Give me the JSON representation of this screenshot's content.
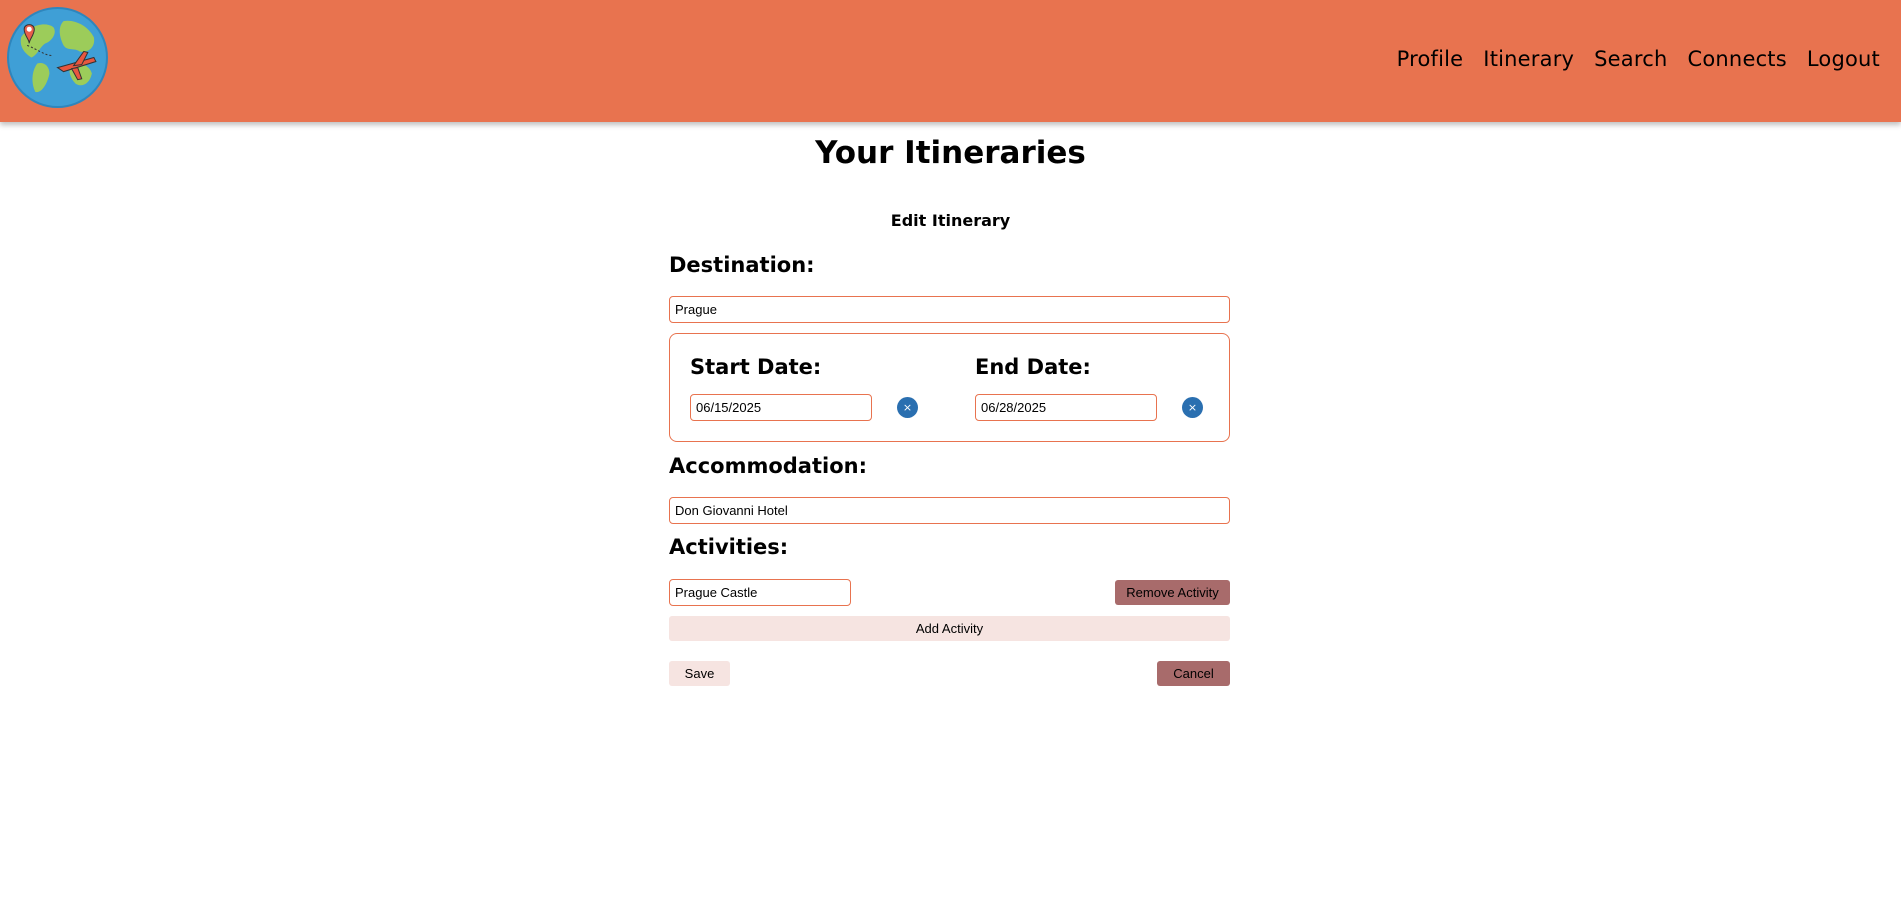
{
  "nav": {
    "links": [
      "Profile",
      "Itinerary",
      "Search",
      "Connects",
      "Logout"
    ]
  },
  "page": {
    "title": "Your Itineraries"
  },
  "form": {
    "title": "Edit Itinerary",
    "destination_label": "Destination:",
    "destination_value": "Prague",
    "start_date_label": "Start Date:",
    "start_date_value": "06/15/2025",
    "end_date_label": "End Date:",
    "end_date_value": "06/28/2025",
    "clear_glyph": "×",
    "accommodation_label": "Accommodation:",
    "accommodation_value": "Don Giovanni Hotel",
    "activities_label": "Activities:",
    "activities": [
      {
        "value": "Prague Castle",
        "remove_label": "Remove Activity"
      }
    ],
    "add_activity_label": "Add Activity",
    "save_label": "Save",
    "cancel_label": "Cancel"
  },
  "colors": {
    "header_bg": "#e8734f",
    "input_border": "#e8734f",
    "clear_button": "#2a6fb0",
    "light_button": "#f6e4e1",
    "dark_button": "#a86b6b"
  },
  "icons": {
    "logo": "globe-airplane-logo",
    "clear": "clear-date-icon"
  }
}
